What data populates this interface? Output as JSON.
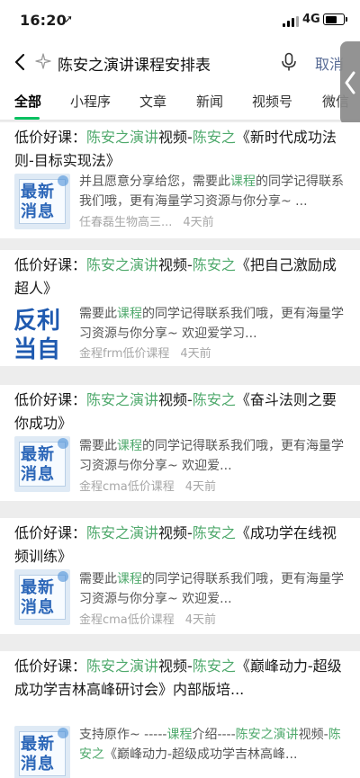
{
  "status": {
    "time": "16:20",
    "network": "4G",
    "battery_level": 0.72
  },
  "search": {
    "query": "陈安之演讲课程安排表",
    "cancel_label": "取消"
  },
  "tabs": [
    {
      "label": "全部"
    },
    {
      "label": "小程序"
    },
    {
      "label": "文章"
    },
    {
      "label": "新闻"
    },
    {
      "label": "视频号"
    },
    {
      "label": "微信"
    }
  ],
  "results": [
    {
      "title": [
        {
          "t": "低价好课："
        },
        {
          "t": "陈安之演讲",
          "hl": true
        },
        {
          "t": "视频-"
        },
        {
          "t": "陈安之",
          "hl": true
        },
        {
          "t": "《新时代成功法则-目标实现法》"
        }
      ],
      "thumb": "news",
      "thumb_lines": [
        "最新",
        "消息"
      ],
      "desc": [
        {
          "t": "并且愿意分享给您，需要此"
        },
        {
          "t": "课程",
          "hl": true
        },
        {
          "t": "的同学记得联系我们哦，更有海量学习资源与你分享~ ..."
        }
      ],
      "source": "任春磊生物高三...",
      "time": "4天前"
    },
    {
      "title": [
        {
          "t": "低价好课："
        },
        {
          "t": "陈安之演讲",
          "hl": true
        },
        {
          "t": "视频-"
        },
        {
          "t": "陈安之",
          "hl": true
        },
        {
          "t": "《把自己激励成超人》"
        }
      ],
      "thumb": "fanli",
      "thumb_lines": [
        "反利",
        "当自"
      ],
      "desc": [
        {
          "t": "需要此"
        },
        {
          "t": "课程",
          "hl": true
        },
        {
          "t": "的同学记得联系我们哦，更有海量学习资源与你分享~ 欢迎爱学习..."
        }
      ],
      "source": "金程frm低价课程",
      "time": "4天前"
    },
    {
      "title": [
        {
          "t": "低价好课："
        },
        {
          "t": "陈安之演讲",
          "hl": true
        },
        {
          "t": "视频-"
        },
        {
          "t": "陈安之",
          "hl": true
        },
        {
          "t": "《奋斗法则之要你成功》"
        }
      ],
      "thumb": "news",
      "thumb_lines": [
        "最新",
        "消息"
      ],
      "desc": [
        {
          "t": "需要此"
        },
        {
          "t": "课程",
          "hl": true
        },
        {
          "t": "的同学记得联系我们哦，更有海量学习资源与你分享~ 欢迎爱..."
        }
      ],
      "source": "金程cma低价课程",
      "time": "4天前"
    },
    {
      "title": [
        {
          "t": "低价好课："
        },
        {
          "t": "陈安之演讲",
          "hl": true
        },
        {
          "t": "视频-"
        },
        {
          "t": "陈安之",
          "hl": true
        },
        {
          "t": "《成功学在线视频训练》"
        }
      ],
      "thumb": "news",
      "thumb_lines": [
        "最新",
        "消息"
      ],
      "desc": [
        {
          "t": "需要此"
        },
        {
          "t": "课程",
          "hl": true
        },
        {
          "t": "的同学记得联系我们哦，更有海量学习资源与你分享~ 欢迎爱..."
        }
      ],
      "source": "金程cma低价课程",
      "time": "4天前"
    },
    {
      "title": [
        {
          "t": "低价好课："
        },
        {
          "t": "陈安之演讲",
          "hl": true
        },
        {
          "t": "视频-"
        },
        {
          "t": "陈安之",
          "hl": true
        },
        {
          "t": "《巅峰动力-超级成功学吉林高峰研讨会》内部版培..."
        }
      ],
      "thumb": "news",
      "thumb_lines": [
        "最新",
        "消息"
      ],
      "desc": [
        {
          "t": "支持原作~ -----"
        },
        {
          "t": "课程",
          "hl": true
        },
        {
          "t": "介绍----"
        },
        {
          "t": "陈安之演讲",
          "hl": true
        },
        {
          "t": "视频-"
        },
        {
          "t": "陈安之",
          "hl": true
        },
        {
          "t": "《巅峰动力-超级成功学吉林高峰..."
        }
      ],
      "source": "",
      "time": ""
    }
  ],
  "colors": {
    "highlight": "#4fa96c",
    "tab_indicator": "#07c160",
    "link": "#576b95"
  }
}
